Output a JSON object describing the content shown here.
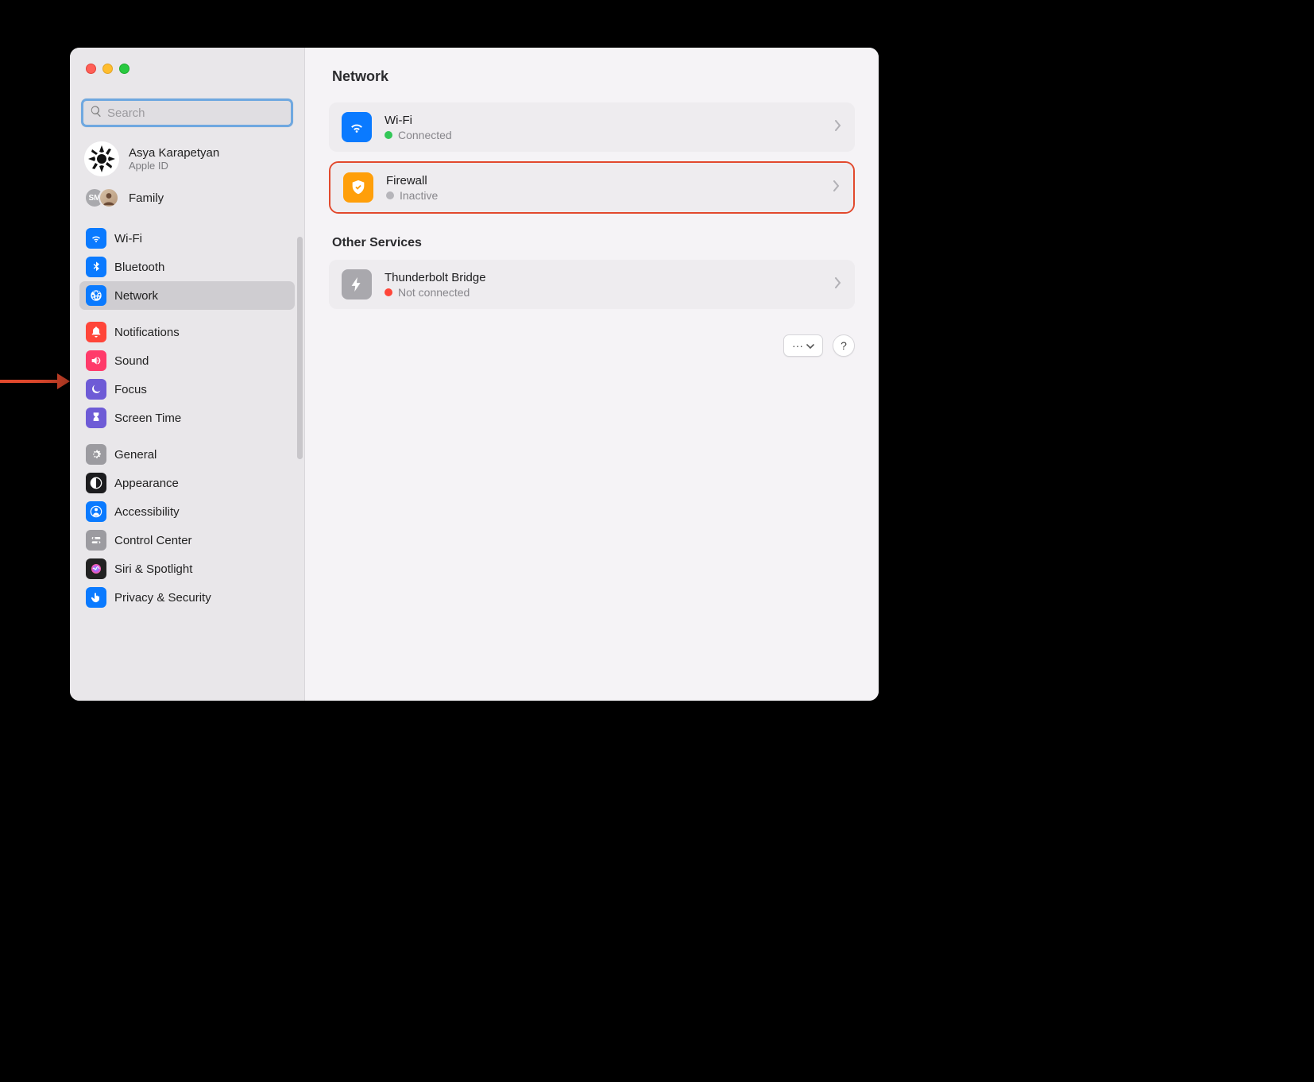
{
  "search": {
    "placeholder": "Search"
  },
  "account": {
    "name": "Asya Karapetyan",
    "sub": "Apple ID"
  },
  "family": {
    "label": "Family",
    "badge": "SM"
  },
  "sidebar": {
    "groups": [
      [
        {
          "label": "Wi-Fi",
          "icon": "wifi",
          "color": "#0a7aff"
        },
        {
          "label": "Bluetooth",
          "icon": "bluetooth",
          "color": "#0a7aff"
        },
        {
          "label": "Network",
          "icon": "globe",
          "color": "#0a7aff",
          "selected": true
        }
      ],
      [
        {
          "label": "Notifications",
          "icon": "bell",
          "color": "#ff4539"
        },
        {
          "label": "Sound",
          "icon": "sound",
          "color": "#ff3b6a"
        },
        {
          "label": "Focus",
          "icon": "moon",
          "color": "#6e5bd6"
        },
        {
          "label": "Screen Time",
          "icon": "hourglass",
          "color": "#6e5bd6"
        }
      ],
      [
        {
          "label": "General",
          "icon": "gear",
          "color": "#9c9ba0"
        },
        {
          "label": "Appearance",
          "icon": "contrast",
          "color": "#1c1c1e"
        },
        {
          "label": "Accessibility",
          "icon": "person",
          "color": "#0a7aff"
        },
        {
          "label": "Control Center",
          "icon": "switches",
          "color": "#9c9ba0"
        },
        {
          "label": "Siri & Spotlight",
          "icon": "siri",
          "color": "#222"
        },
        {
          "label": "Privacy & Security",
          "icon": "hand",
          "color": "#0a7aff"
        }
      ]
    ]
  },
  "page": {
    "title": "Network",
    "services": [
      {
        "title": "Wi-Fi",
        "status": "Connected",
        "dot": "#33c758",
        "icon": "wifi",
        "color": "#0a7aff"
      }
    ],
    "firewall": {
      "title": "Firewall",
      "status": "Inactive",
      "dot": "#b6b5ba",
      "icon": "shield",
      "color": "#ff9f0a"
    },
    "other_title": "Other Services",
    "other": [
      {
        "title": "Thunderbolt Bridge",
        "status": "Not connected",
        "dot": "#ff4539",
        "icon": "bolt",
        "color": "#a9a8ad"
      }
    ],
    "more_label": "···",
    "help_label": "?"
  }
}
